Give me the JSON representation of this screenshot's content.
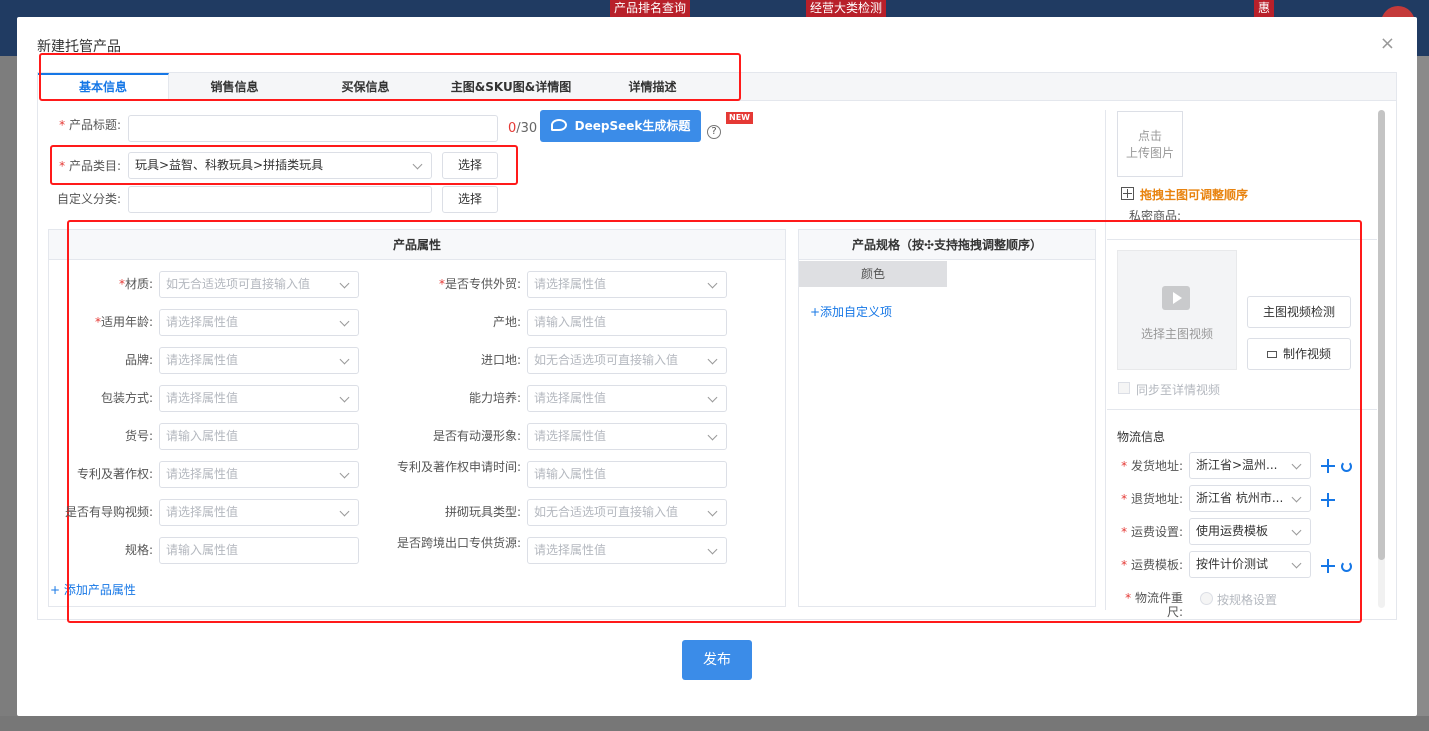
{
  "background": {
    "tags": [
      "产品排名查询",
      "经营大类检测",
      "惠"
    ]
  },
  "modal": {
    "title": "新建托管产品",
    "close": "×"
  },
  "tabs": [
    "基本信息",
    "销售信息",
    "买保信息",
    "主图&SKU图&详情图",
    "详情描述"
  ],
  "basic": {
    "title_label": "产品标题:",
    "title_value": "",
    "title_count": "0",
    "title_max": "/30",
    "deepseek_btn": "DeepSeek生成标题",
    "help": "?",
    "new_badge": "NEW",
    "category_label": "产品类目:",
    "category_value": "玩具>益智、科教玩具>拼插类玩具",
    "category_select_btn": "选择",
    "custom_label": "自定义分类:",
    "custom_value": "",
    "custom_select_btn": "选择"
  },
  "attributes": {
    "header": "产品属性",
    "left": [
      {
        "label": "材质:",
        "required": true,
        "placeholder": "如无合适选项可直接输入值",
        "dropdown": true
      },
      {
        "label": "适用年龄:",
        "required": true,
        "placeholder": "请选择属性值",
        "dropdown": true
      },
      {
        "label": "品牌:",
        "required": false,
        "placeholder": "请选择属性值",
        "dropdown": true
      },
      {
        "label": "包装方式:",
        "required": false,
        "placeholder": "请选择属性值",
        "dropdown": true
      },
      {
        "label": "货号:",
        "required": false,
        "placeholder": "请输入属性值",
        "dropdown": false
      },
      {
        "label": "专利及著作权:",
        "required": false,
        "placeholder": "请选择属性值",
        "dropdown": true
      },
      {
        "label": "是否有导购视频:",
        "required": false,
        "placeholder": "请选择属性值",
        "dropdown": true
      },
      {
        "label": "规格:",
        "required": false,
        "placeholder": "请输入属性值",
        "dropdown": false
      }
    ],
    "right": [
      {
        "label": "是否专供外贸:",
        "required": true,
        "placeholder": "请选择属性值",
        "dropdown": true
      },
      {
        "label": "产地:",
        "required": false,
        "placeholder": "请输入属性值",
        "dropdown": false
      },
      {
        "label": "进口地:",
        "required": false,
        "placeholder": "如无合适选项可直接输入值",
        "dropdown": true
      },
      {
        "label": "能力培养:",
        "required": false,
        "placeholder": "请选择属性值",
        "dropdown": true
      },
      {
        "label": "是否有动漫形象:",
        "required": false,
        "placeholder": "请选择属性值",
        "dropdown": true
      },
      {
        "label": "专利及著作权申请时间:",
        "required": false,
        "placeholder": "请输入属性值",
        "dropdown": false
      },
      {
        "label": "拼砌玩具类型:",
        "required": false,
        "placeholder": "如无合适选项可直接输入值",
        "dropdown": true
      },
      {
        "label": "是否跨境出口专供货源:",
        "required": false,
        "placeholder": "请选择属性值",
        "dropdown": true
      }
    ],
    "add_link": "+ 添加产品属性"
  },
  "spec": {
    "header": "产品规格（按✣支持拖拽调整顺序）",
    "color_col": "颜色",
    "add_link": "+添加自定义项"
  },
  "media": {
    "upload_line1": "点击",
    "upload_line2": "上传图片",
    "drag_hint": "拖拽主图可调整顺序",
    "private_label": "私密商品:",
    "video_label": "选择主图视频",
    "video_check_btn": "主图视频检测",
    "make_video_btn": "制作视频",
    "sync_label": "同步至详情视频"
  },
  "logistics": {
    "title": "物流信息",
    "ship_label": "发货地址:",
    "ship_value": "浙江省>温州...",
    "return_label": "退货地址:",
    "return_value": "浙江省 杭州市...",
    "freight_label": "运费设置:",
    "freight_value": "使用运费模板",
    "template_label": "运费模板:",
    "template_value": "按件计价测试",
    "weight_label": "物流件重尺:",
    "weight_option": "按规格设置"
  },
  "footer": {
    "publish": "发布"
  }
}
